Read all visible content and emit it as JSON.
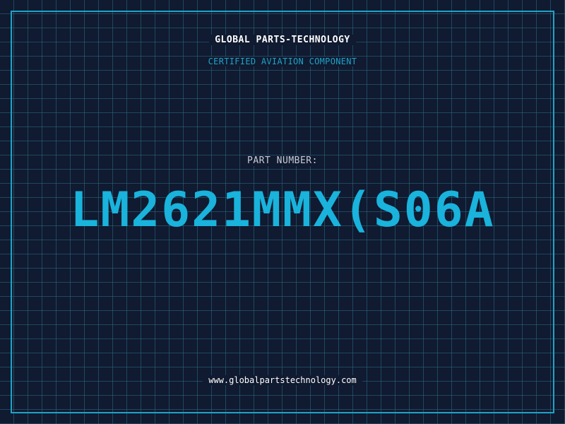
{
  "header": {
    "company": "GLOBAL PARTS-TECHNOLOGY",
    "tagline": "CERTIFIED AVIATION COMPONENT"
  },
  "part": {
    "label": "PART NUMBER:",
    "number": "LM2621MMX(S06A"
  },
  "footer": {
    "website": "www.globalpartstechnology.com"
  },
  "colors": {
    "background": "#101a30",
    "grid": "#2a6e82",
    "accent": "#1fa2c8",
    "part_number": "#19b3dc",
    "text": "#ffffff"
  }
}
